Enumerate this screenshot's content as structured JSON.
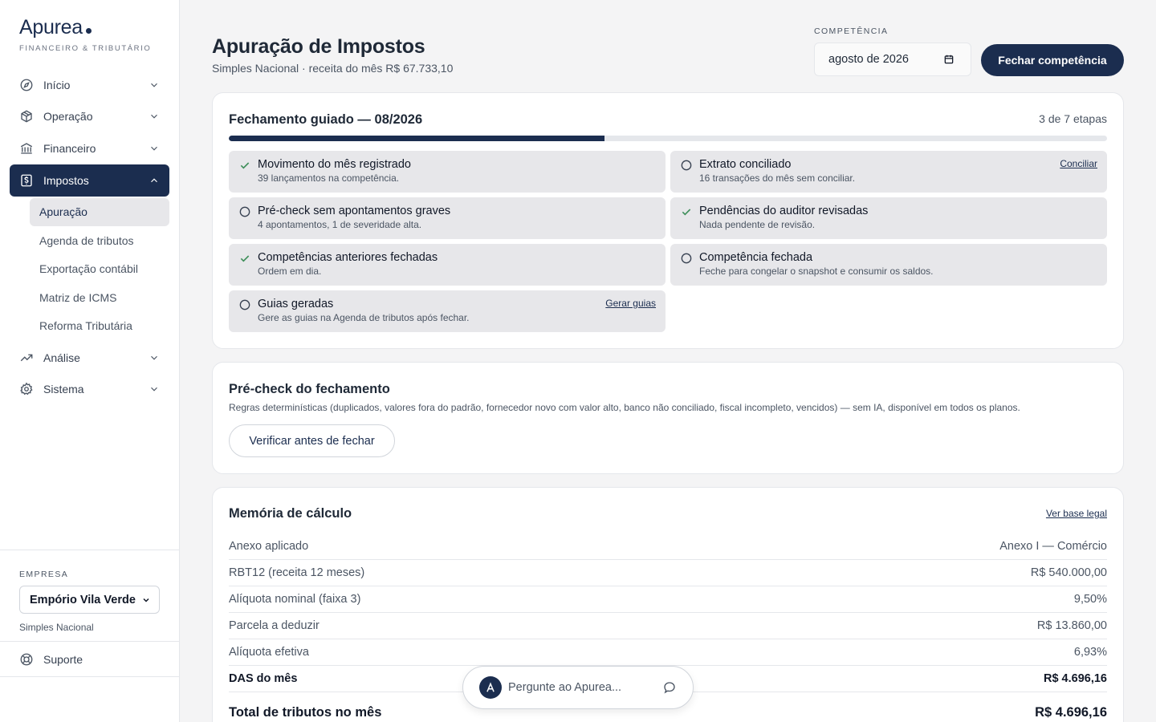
{
  "brand": {
    "name": "Apurea",
    "tagline": "FINANCEIRO & TRIBUTÁRIO"
  },
  "sidebar": {
    "items": [
      {
        "label": "Início",
        "icon": "compass-icon"
      },
      {
        "label": "Operação",
        "icon": "box-icon"
      },
      {
        "label": "Financeiro",
        "icon": "bank-icon"
      },
      {
        "label": "Impostos",
        "icon": "receipt-icon",
        "active": true
      },
      {
        "label": "Análise",
        "icon": "trending-up-icon"
      },
      {
        "label": "Sistema",
        "icon": "gear-icon"
      }
    ],
    "sub_items": [
      {
        "label": "Apuração",
        "active": true
      },
      {
        "label": "Agenda de tributos"
      },
      {
        "label": "Exportação contábil"
      },
      {
        "label": "Matriz de ICMS"
      },
      {
        "label": "Reforma Tributária"
      }
    ],
    "company_label": "EMPRESA",
    "company_value": "Empório Vila Verde",
    "company_regime": "Simples Nacional",
    "support_label": "Suporte"
  },
  "header": {
    "title": "Apuração de Impostos",
    "subtitle": "Simples Nacional · receita do mês R$ 67.733,10",
    "competencia_label": "COMPETÊNCIA",
    "competencia_value": "agosto de 2026",
    "close_button": "Fechar competência"
  },
  "guided": {
    "title": "Fechamento guiado — 08/2026",
    "steps_count": "3 de 7 etapas",
    "progress": 0.428,
    "steps": [
      {
        "title": "Movimento do mês registrado",
        "desc": "39 lançamentos na competência.",
        "done": true,
        "link": ""
      },
      {
        "title": "Extrato conciliado",
        "desc": "16 transações do mês sem conciliar.",
        "done": false,
        "link": "Conciliar"
      },
      {
        "title": "Pré-check sem apontamentos graves",
        "desc": "4 apontamentos, 1 de severidade alta.",
        "done": false,
        "link": ""
      },
      {
        "title": "Pendências do auditor revisadas",
        "desc": "Nada pendente de revisão.",
        "done": true,
        "link": ""
      },
      {
        "title": "Competências anteriores fechadas",
        "desc": "Ordem em dia.",
        "done": true,
        "link": ""
      },
      {
        "title": "Competência fechada",
        "desc": "Feche para congelar o snapshot e consumir os saldos.",
        "done": false,
        "link": ""
      },
      {
        "title": "Guias geradas",
        "desc": "Gere as guias na Agenda de tributos após fechar.",
        "done": false,
        "link": "Gerar guias"
      }
    ]
  },
  "precheck": {
    "title": "Pré-check do fechamento",
    "desc": "Regras determinísticas (duplicados, valores fora do padrão, fornecedor novo com valor alto, banco não conciliado, fiscal incompleto, vencidos) — sem IA, disponível em todos os planos.",
    "button": "Verificar antes de fechar"
  },
  "calc": {
    "title": "Memória de cálculo",
    "link": "Ver base legal",
    "rows": [
      {
        "label": "Anexo aplicado",
        "value": "Anexo I — Comércio"
      },
      {
        "label": "RBT12 (receita 12 meses)",
        "value": "R$ 540.000,00"
      },
      {
        "label": "Alíquota nominal (faixa 3)",
        "value": "9,50%"
      },
      {
        "label": "Parcela a deduzir",
        "value": "R$ 13.860,00"
      },
      {
        "label": "Alíquota efetiva",
        "value": "6,93%"
      },
      {
        "label": "DAS do mês",
        "value": "R$ 4.696,16"
      }
    ],
    "total_label": "Total de tributos no mês",
    "total_value": "R$ 4.696,16"
  },
  "assistant": {
    "placeholder": "Pergunte ao Apurea..."
  },
  "colors": {
    "primary": "#1b2d4f",
    "background": "#f4f4f5",
    "step_bg": "#e7e7ea"
  }
}
